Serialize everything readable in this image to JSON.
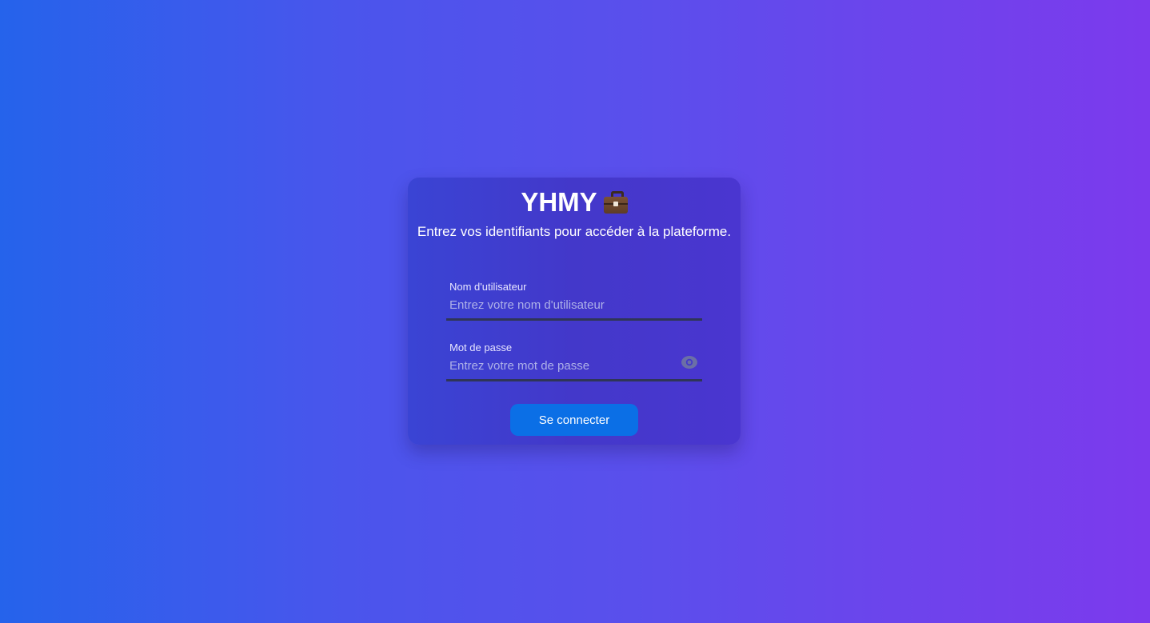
{
  "login": {
    "brand": "YHMY",
    "brand_icon": "briefcase-icon",
    "subtitle": "Entrez vos identifiants pour accéder à la plateforme.",
    "username": {
      "label": "Nom d'utilisateur",
      "placeholder": "Entrez votre nom d'utilisateur",
      "value": ""
    },
    "password": {
      "label": "Mot de passe",
      "placeholder": "Entrez votre mot de passe",
      "value": "",
      "toggle_icon": "eye-icon"
    },
    "submit_label": "Se connecter"
  },
  "colors": {
    "background_start": "#2563eb",
    "background_end": "#7c3aed",
    "card": "#4338ca",
    "button": "#0b6fe6"
  }
}
